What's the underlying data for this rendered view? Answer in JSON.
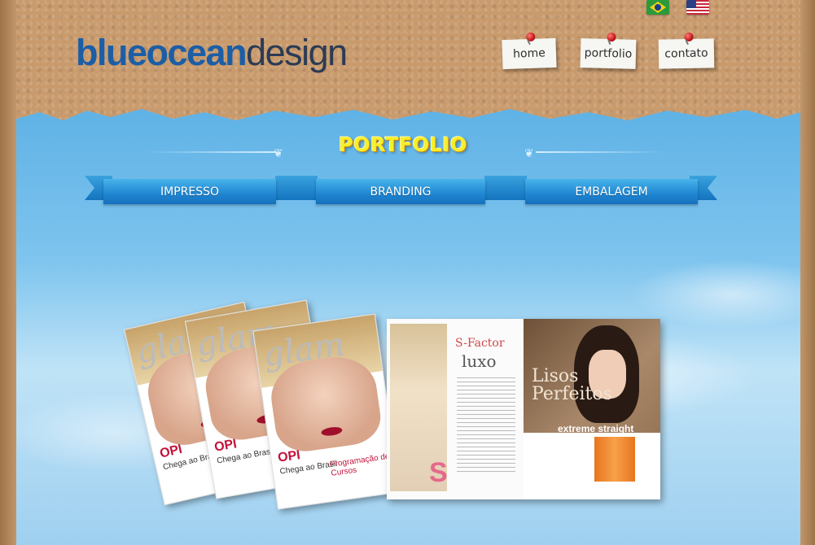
{
  "header": {
    "logo": {
      "bold": "blueocean",
      "light": "design"
    },
    "languages": [
      {
        "icon": "brazil-flag-icon"
      },
      {
        "icon": "us-flag-icon"
      }
    ],
    "nav": [
      {
        "label": "home"
      },
      {
        "label": "portfolio"
      },
      {
        "label": "contato"
      }
    ]
  },
  "main": {
    "title": "PORTFOLIO",
    "tabs": [
      {
        "label": "IMPRESSO"
      },
      {
        "label": "BRANDING"
      },
      {
        "label": "EMBALAGEM"
      }
    ],
    "magazine": {
      "masthead": "glam",
      "headline": "OPI",
      "sub1": "Chega ao Brasil",
      "sub2": "Programação de Cursos"
    },
    "spread": {
      "left_title": "S-Factor",
      "left_subtitle": "luxo",
      "right_title": "Lisos Perfeitos",
      "right_subtitle": "extreme straight"
    }
  },
  "colors": {
    "title_yellow": "#f7ef2a",
    "ribbon_blue": "#1f86d2",
    "logo_blue": "#1c5ea6",
    "pin_red": "#c51616"
  }
}
